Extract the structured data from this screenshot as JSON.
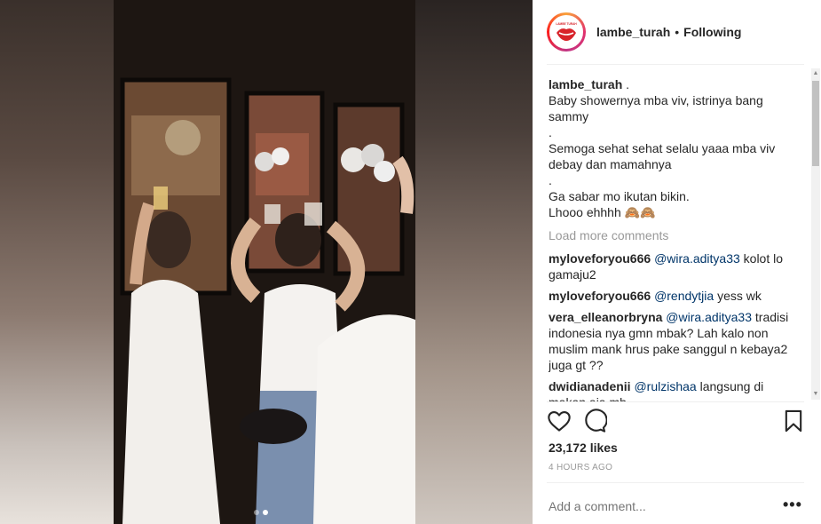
{
  "media": {
    "carousel_dots": [
      {
        "active": false
      },
      {
        "active": true
      }
    ]
  },
  "header": {
    "username": "lambe_turah",
    "separator": "•",
    "follow_status": "Following",
    "avatar_logo_text": "LAMBE TURAH"
  },
  "caption": {
    "username": "lambe_turah",
    "lines": [
      ".",
      "Baby showernya mba viv, istrinya bang sammy",
      ".",
      "Semoga sehat sehat selalu yaaa mba viv debay dan mamahnya",
      ".",
      "Ga sabar mo ikutan bikin.",
      "Lhooo ehhhh 🙈🙈"
    ]
  },
  "load_more": "Load more comments",
  "comments": [
    {
      "username": "myloveforyou666",
      "mention": "@wira.aditya33",
      "text": "kolot lo gamaju2"
    },
    {
      "username": "myloveforyou666",
      "mention": "@rendytjia",
      "text": "yess wk"
    },
    {
      "username": "vera_elleanorbryna",
      "mention": "@wira.aditya33",
      "text": "tradisi indonesia nya gmn mbak? Lah kalo non muslim mank hrus pake sanggul n kebaya2 juga gt ??"
    },
    {
      "username": "dwidianadenii",
      "mention": "@rulzishaa",
      "text": "langsung di makan aja mb"
    }
  ],
  "actions": {
    "like_icon": "heart-outline-icon",
    "comment_icon": "comment-bubble-icon",
    "save_icon": "bookmark-icon"
  },
  "likes": "23,172 likes",
  "timestamp": "4 HOURS AGO",
  "add_comment_placeholder": "Add a comment...",
  "more_options": "•••",
  "colors": {
    "text": "#262626",
    "muted": "#999999",
    "mention": "#003569",
    "divider": "#efefef"
  }
}
